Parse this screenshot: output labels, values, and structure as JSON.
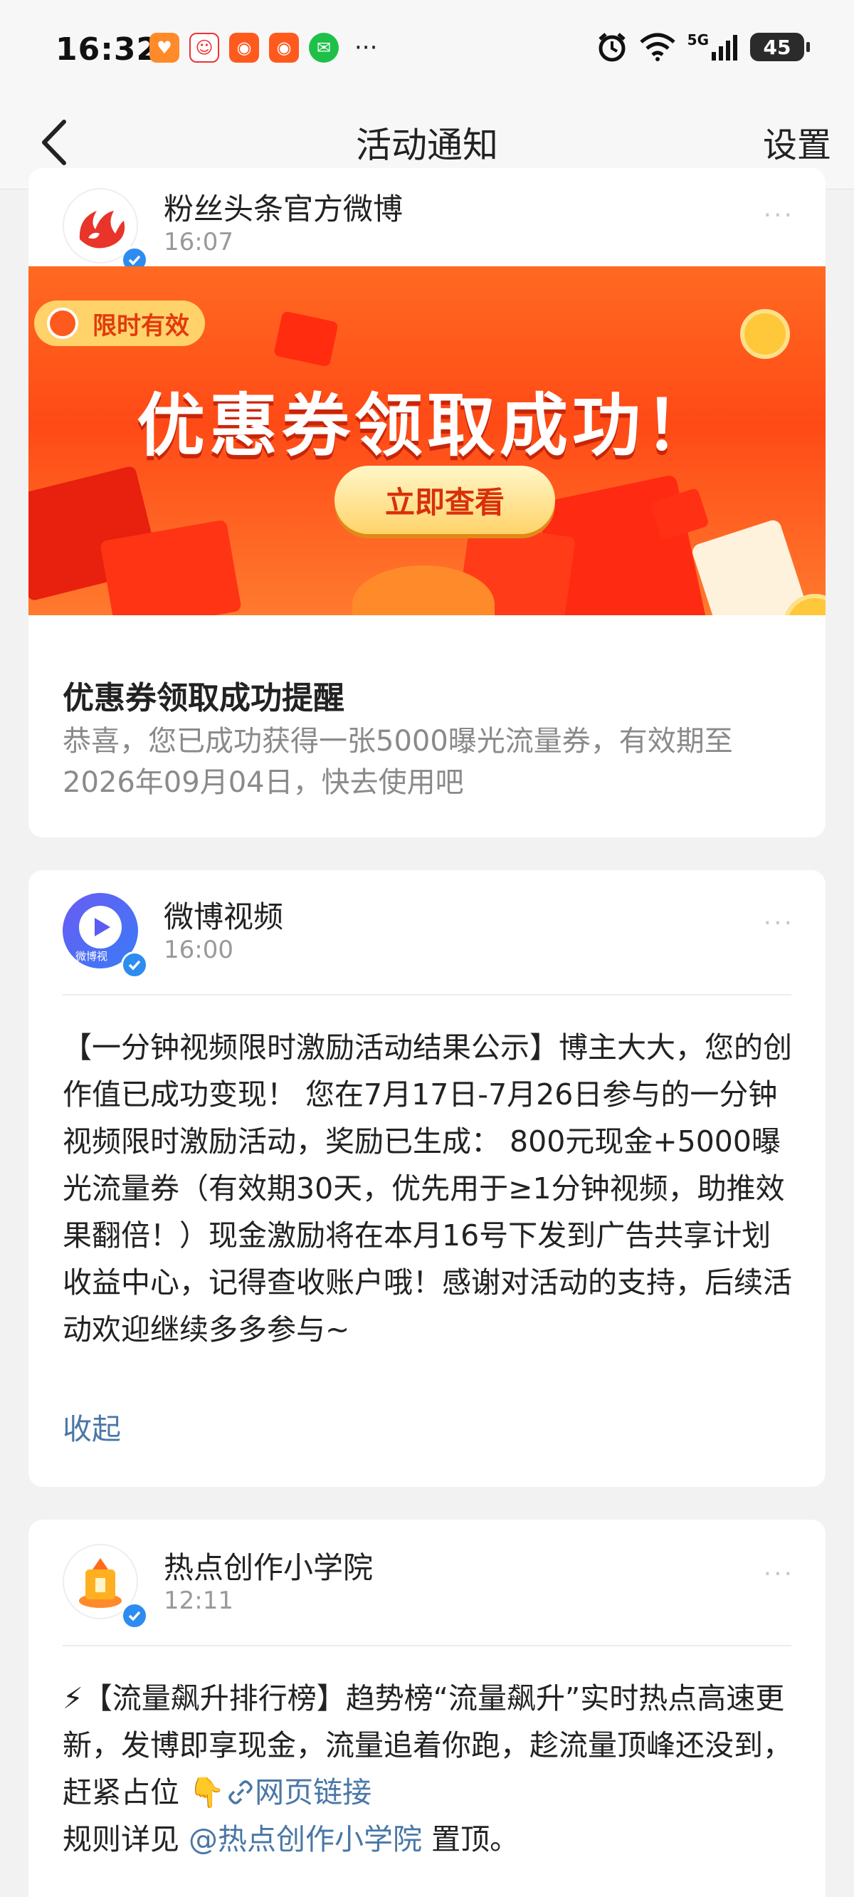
{
  "status_bar": {
    "time": "16:32",
    "more": "···",
    "network": "5G",
    "battery": "45"
  },
  "nav": {
    "title": "活动通知",
    "settings": "设置"
  },
  "cards": [
    {
      "sender": "粉丝头条官方微博",
      "time": "16:07",
      "more": "···",
      "banner": {
        "tag": "限时有效",
        "headline": "优惠券领取成功！",
        "button": "立即查看"
      },
      "title": "优惠券领取成功提醒",
      "desc": "恭喜，您已成功获得一张5000曝光流量券，有效期至2026年09月04日，快去使用吧"
    },
    {
      "sender": "微博视频",
      "time": "16:00",
      "more": "···",
      "avatar_text": "微博视",
      "body": "【一分钟视频限时激励活动结果公示】博主大大，您的创作值已成功变现！ 您在7月17日-7月26日参与的一分钟视频限时激励活动，奖励已生成： 800元现金+5000曝光流量券（有效期30天，优先用于≥1分钟视频，助推效果翻倍！）现金激励将在本月16号下发到广告共享计划收益中心，记得查收账户哦！感谢对活动的支持，后续活动欢迎继续多多参与~",
      "collapse": "收起"
    },
    {
      "sender": "热点创作小学院",
      "time": "12:11",
      "more": "···",
      "body_main": "⚡【流量飙升排行榜】趋势榜“流量飙升”实时热点高速更新，发博即享现金，流量追着你跑，趁流量顶峰还没到，赶紧占位 👇",
      "link_text": "网页链接",
      "rules_prefix": "规则详见",
      "mention": "@热点创作小学院",
      "rules_suffix": "置顶。"
    }
  ],
  "colors": {
    "accent_link": "#4a77a6",
    "verified_blue": "#2d8cf0",
    "banner_orange": "#ff4a16"
  }
}
